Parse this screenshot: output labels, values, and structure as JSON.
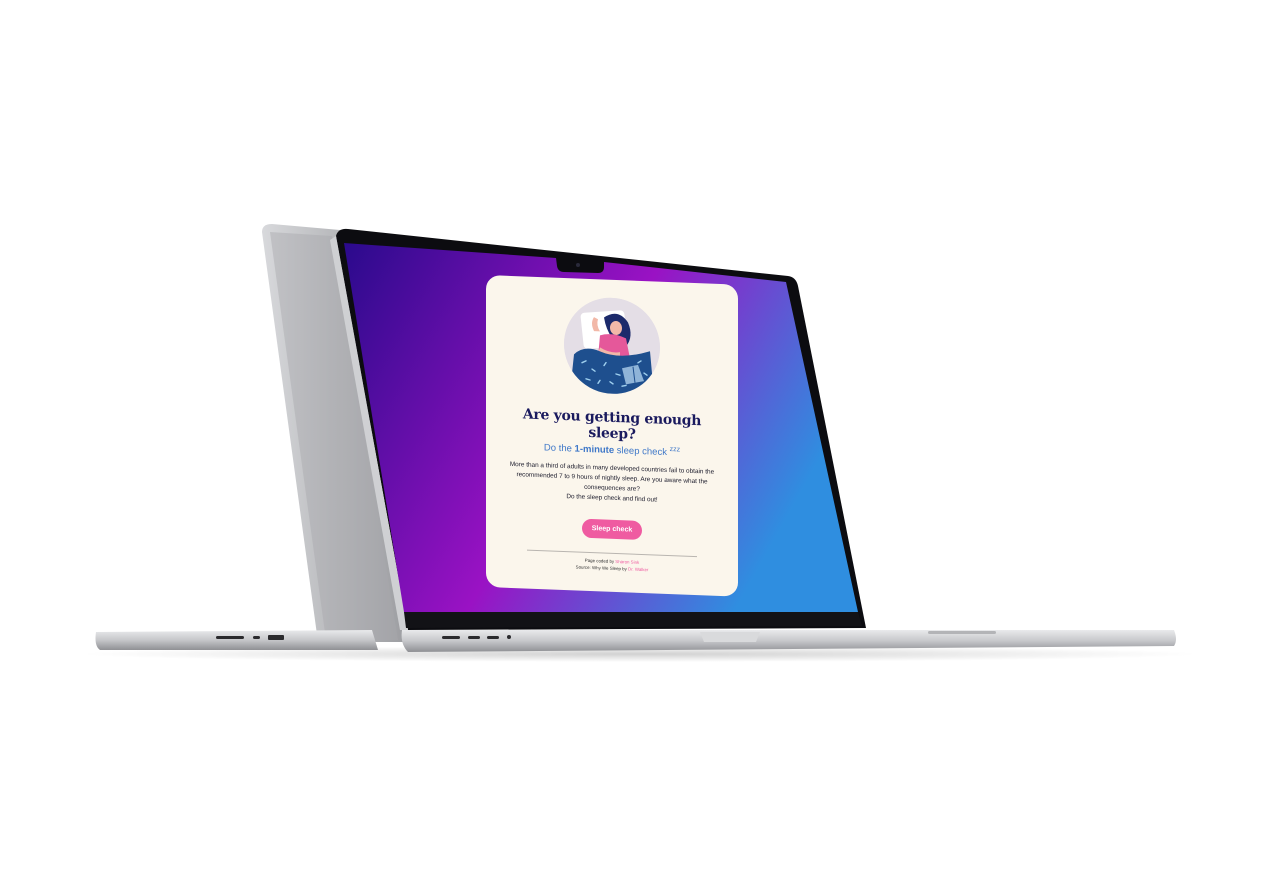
{
  "colors": {
    "screen_gradient_start": "#2a0a8c",
    "screen_gradient_mid": "#9a12c4",
    "screen_gradient_end": "#2f8ee0",
    "card_background": "#fbf6ec",
    "title": "#1a1a5e",
    "accent_blue": "#3f78c8",
    "accent_pink": "#ef5ba1",
    "laptop_silver": "#c9cacd"
  },
  "card": {
    "title": "Are you getting enough sleep?",
    "subtitle_prefix": "Do the ",
    "subtitle_bold": "1-minute",
    "subtitle_suffix": " sleep check",
    "subtitle_icon": "zzz",
    "body_line1": "More than a third of adults in many developed countries fail to obtain the recommended 7 to 9 hours of nightly sleep. Are you aware what the consequences are?",
    "body_line2": "Do the sleep check and find out!",
    "cta_label": "Sleep check",
    "credits": {
      "coded_prefix": "Page coded by ",
      "coded_name": "Sharon Sink",
      "source_prefix": "Source: Why We Sleep by ",
      "source_name": "Dr. Walker"
    }
  },
  "illustration": {
    "icon": "sleeping-woman-illustration"
  }
}
